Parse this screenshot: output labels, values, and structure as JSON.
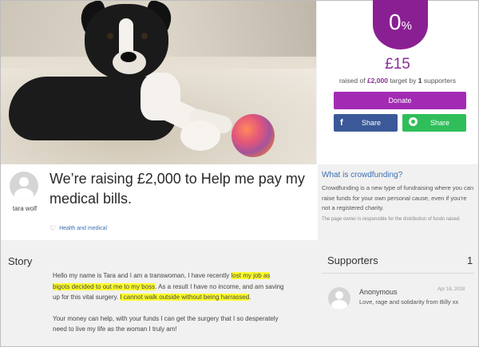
{
  "campaign": {
    "title": "We’re raising £2,000 to Help me pay my medical bills.",
    "owner_name": "tara wolf",
    "category": "Health and medical"
  },
  "progress": {
    "percent_value": "0",
    "percent_sign": "%",
    "percent": 0,
    "raised_amount": "£15",
    "raised_prefix": "raised of",
    "target": "£2,000",
    "target_suffix": "target by",
    "supporter_count": "1",
    "supporters_word": "supporters"
  },
  "actions": {
    "donate_label": "Donate",
    "facebook_share_label": "Share",
    "whatsapp_share_label": "Share"
  },
  "crowdfunding_info": {
    "title": "What is crowdfunding?",
    "text": "Crowdfunding is a new type of fundraising where you can raise funds for your own personal cause, even if you're not a registered charity.",
    "note": "The page owner is responsible for the distribution of funds raised."
  },
  "story": {
    "heading": "Story",
    "p1_a": "Hello my name is Tara and I am a transwoman, I have recently ",
    "p1_hl1": "lost my job as bigots decided to out me to my boss",
    "p1_b": ". As a result I have no income, and am saving up for this vital surgery. ",
    "p1_hl2": "I cannot walk outside without being harrassed",
    "p1_c": ".",
    "p2": "Your money can help, with your funds I can get the surgery that I so desperately need to live my life as the woman I truly am!"
  },
  "supporters": {
    "heading": "Supporters",
    "count": "1",
    "items": [
      {
        "name": "Anonymous",
        "date": "Apr 16, 2018",
        "message": "Love, rage and solidarity from Billy xx"
      }
    ]
  },
  "colors": {
    "brand_purple": "#8a1f93",
    "donate_button": "#a32bb3",
    "facebook": "#3b5998",
    "whatsapp": "#2fbe5a",
    "link_blue": "#3d6fb0",
    "highlight": "#ffff2e"
  },
  "icons": {
    "facebook": "facebook-icon",
    "whatsapp": "whatsapp-icon",
    "heart": "heart-icon",
    "avatar": "user-avatar-icon"
  }
}
